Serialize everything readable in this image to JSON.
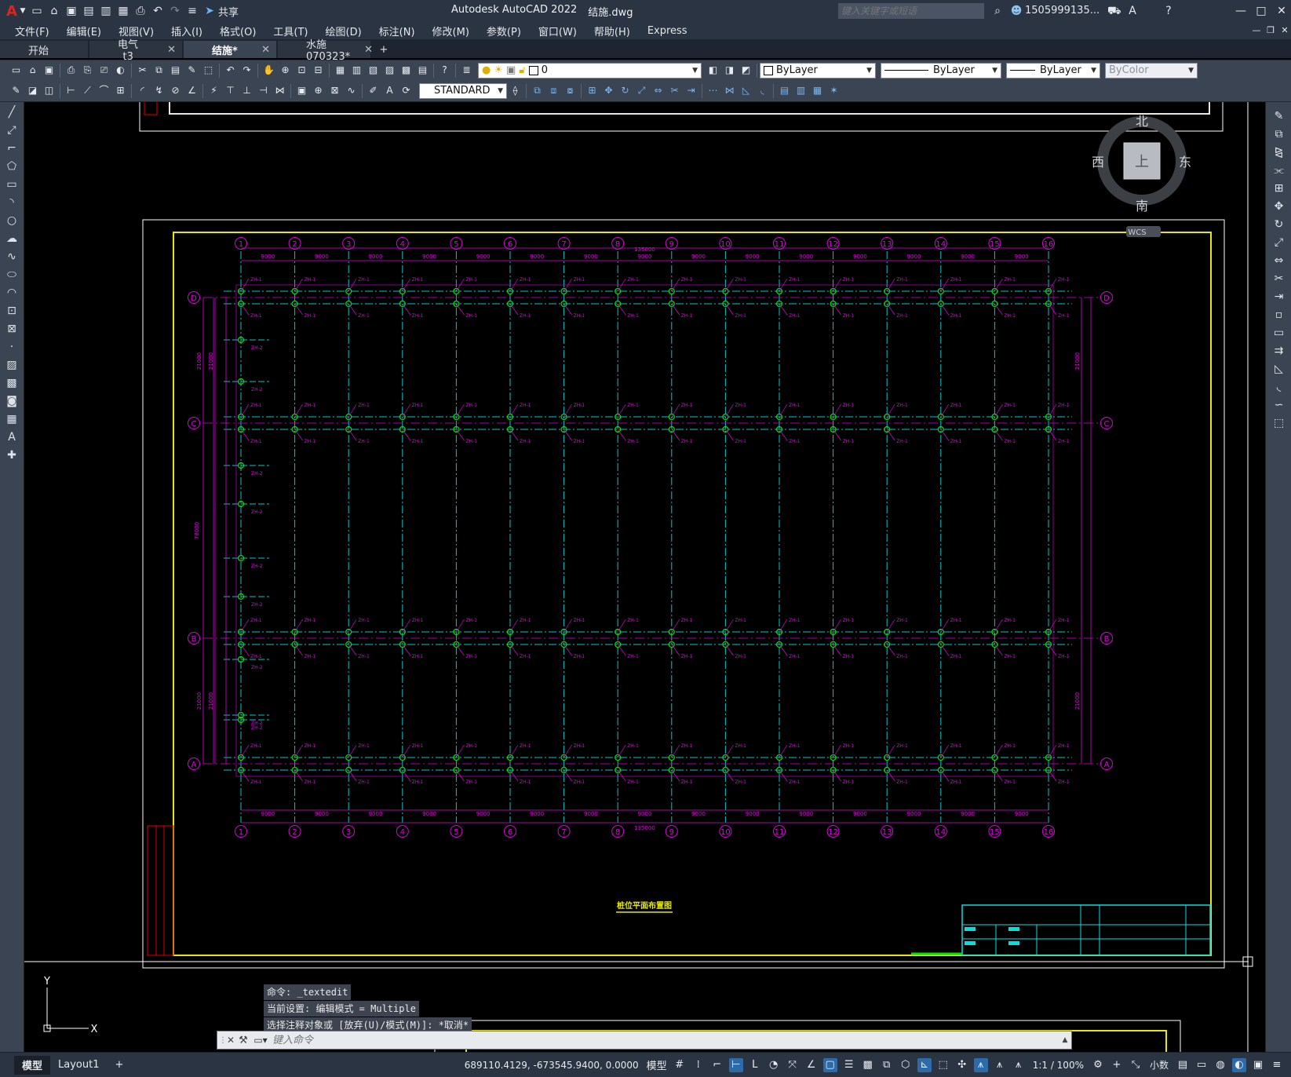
{
  "title": {
    "logo": "A",
    "share": "共享",
    "app": "Autodesk AutoCAD 2022",
    "file": "结施.dwg",
    "search_placeholder": "键入关键字或短语",
    "user": "1505999135..."
  },
  "menu": [
    "文件(F)",
    "编辑(E)",
    "视图(V)",
    "插入(I)",
    "格式(O)",
    "工具(T)",
    "绘图(D)",
    "标注(N)",
    "修改(M)",
    "参数(P)",
    "窗口(W)",
    "帮助(H)",
    "Express"
  ],
  "tabs": [
    {
      "label": "开始",
      "close": ""
    },
    {
      "label": "电气_t3",
      "close": "✕"
    },
    {
      "label": "结施*",
      "close": "✕"
    },
    {
      "label": "水施070323*",
      "close": "✕"
    }
  ],
  "tab_add": "+",
  "toolbar": {
    "layer": "0",
    "color": "ByLayer",
    "linetype": "ByLayer",
    "lineweight": "ByLayer",
    "plotstyle": "ByColor",
    "textstyle": "STANDARD"
  },
  "viewcube": {
    "north": "北",
    "south": "南",
    "east": "东",
    "west": "西",
    "top": "上",
    "wcs": "WCS"
  },
  "drawing": {
    "title": "桩位平面布置图",
    "column_labels": [
      "1",
      "2",
      "3",
      "4",
      "5",
      "6",
      "7",
      "8",
      "9",
      "10",
      "11",
      "12",
      "13",
      "14",
      "15",
      "16"
    ],
    "row_labels": [
      "D",
      "C",
      "B",
      "A"
    ],
    "bay_dim": "9000",
    "total_dim": "135000",
    "side_dims": [
      "21000",
      "21000",
      "78000"
    ],
    "pile_label": "ZH-1",
    "pile_label_2": "ZH-2"
  },
  "ucs": {
    "x": "X",
    "y": "Y"
  },
  "command": {
    "history": [
      "命令: _textedit",
      "当前设置: 编辑模式 = Multiple",
      "选择注释对象或 [放弃(U)/模式(M)]: *取消*"
    ],
    "placeholder": "键入命令"
  },
  "status": {
    "layout_tabs": [
      "模型",
      "Layout1"
    ],
    "add_layout": "+",
    "coords": "689110.4129, -673545.9400, 0.0000",
    "space": "模型",
    "scale": "1:1 / 100%",
    "units": "小数"
  },
  "colors": {
    "magenta": "#e000e0",
    "cyan": "#00c8c8",
    "green": "#00e000",
    "yellow": "#e8e800",
    "red": "#e00000",
    "accent": "#2d6ba8"
  }
}
